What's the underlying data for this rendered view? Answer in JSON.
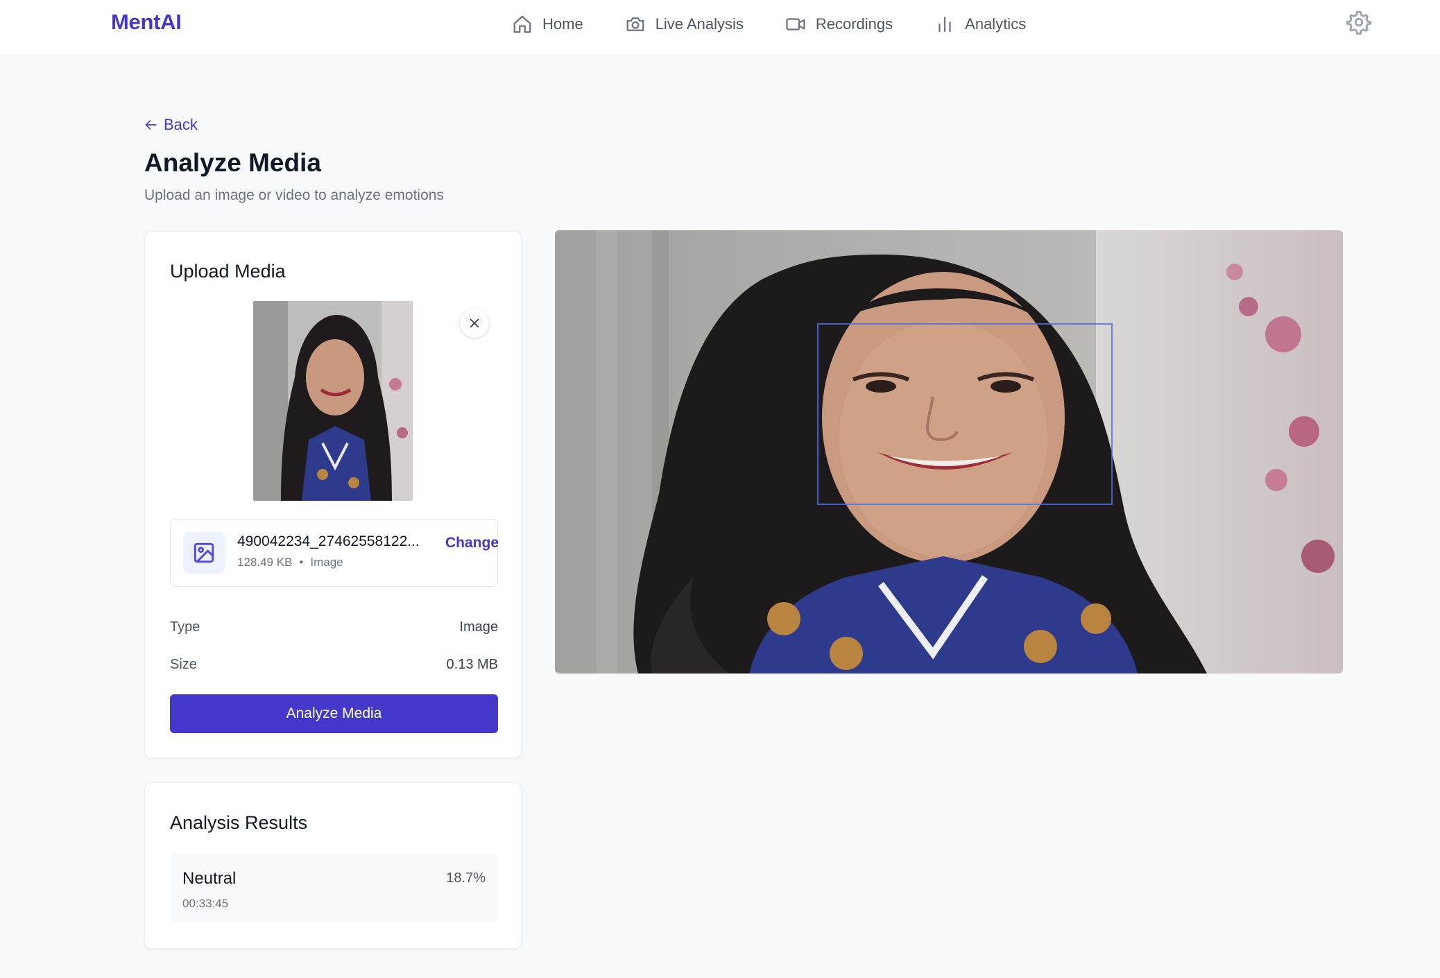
{
  "app": {
    "logo": "MentAI"
  },
  "nav": {
    "items": [
      {
        "label": "Home",
        "icon": "home-icon"
      },
      {
        "label": "Live Analysis",
        "icon": "camera-icon"
      },
      {
        "label": "Recordings",
        "icon": "video-icon"
      },
      {
        "label": "Analytics",
        "icon": "bar-chart-icon"
      }
    ],
    "settings_icon": "gear-icon"
  },
  "page": {
    "back_label": "Back",
    "title": "Analyze Media",
    "subtitle": "Upload an image or video to analyze emotions"
  },
  "upload": {
    "title": "Upload Media",
    "file": {
      "name": "490042234_27462558122...",
      "size": "128.49 KB",
      "kind": "Image",
      "change_label": "Change"
    },
    "details": [
      {
        "key": "Type",
        "value": "Image"
      },
      {
        "key": "Size",
        "value": "0.13 MB"
      }
    ],
    "analyze_label": "Analyze Media"
  },
  "results": {
    "title": "Analysis Results",
    "items": [
      {
        "emotion": "Neutral",
        "time": "00:33:45",
        "confidence": "18.7%"
      }
    ]
  },
  "colors": {
    "accent": "#4338ca",
    "face_box": "#4f6ee0",
    "background": "#f8f9fb"
  }
}
